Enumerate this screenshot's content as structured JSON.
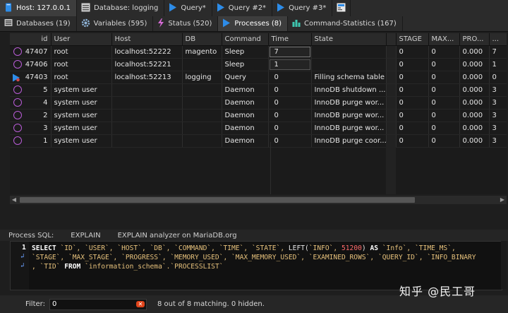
{
  "window_tabs": [
    {
      "label": "Host: 127.0.0.1",
      "icon": "host-icon",
      "active": true
    },
    {
      "label": "Database: logging",
      "icon": "database-icon",
      "active": false
    },
    {
      "label": "Query*",
      "icon": "query-play-icon",
      "active": false
    },
    {
      "label": "Query #2*",
      "icon": "query-play-icon",
      "active": false
    },
    {
      "label": "Query #3*",
      "icon": "query-play-icon",
      "active": false
    }
  ],
  "host_tabs": [
    {
      "label": "Databases (19)",
      "icon": "databases-icon",
      "active": false
    },
    {
      "label": "Variables (595)",
      "icon": "gear-icon",
      "active": false
    },
    {
      "label": "Status (520)",
      "icon": "status-icon",
      "active": false
    },
    {
      "label": "Processes (8)",
      "icon": "play-icon",
      "active": true
    },
    {
      "label": "Command-Statistics (167)",
      "icon": "bar-chart-icon",
      "active": false
    }
  ],
  "grid": {
    "columns": [
      "id",
      "User",
      "Host",
      "DB",
      "Command",
      "Time",
      "State",
      "",
      "STAGE",
      "MAX...",
      "PRO...",
      "..."
    ],
    "rows": [
      {
        "icon": "sleep",
        "id": "47407",
        "user": "root",
        "host": "localhost:52222",
        "db": "magento",
        "command": "Sleep",
        "time": "7",
        "state": "",
        "stage": "0",
        "max": "0",
        "pro": "0.000",
        "extra": "7"
      },
      {
        "icon": "sleep",
        "id": "47406",
        "user": "root",
        "host": "localhost:52221",
        "db": "",
        "command": "Sleep",
        "time": "1",
        "state": "",
        "stage": "0",
        "max": "0",
        "pro": "0.000",
        "extra": "1"
      },
      {
        "icon": "query",
        "id": "47403",
        "user": "root",
        "host": "localhost:52213",
        "db": "logging",
        "command": "Query",
        "time": "0",
        "state": "Filling schema table",
        "stage": "0",
        "max": "0",
        "pro": "0.000",
        "extra": "0"
      },
      {
        "icon": "sleep",
        "id": "5",
        "user": "system user",
        "host": "",
        "db": "",
        "command": "Daemon",
        "time": "0",
        "state": "InnoDB shutdown ...",
        "stage": "0",
        "max": "0",
        "pro": "0.000",
        "extra": "3"
      },
      {
        "icon": "sleep",
        "id": "4",
        "user": "system user",
        "host": "",
        "db": "",
        "command": "Daemon",
        "time": "0",
        "state": "InnoDB purge wor...",
        "stage": "0",
        "max": "0",
        "pro": "0.000",
        "extra": "3"
      },
      {
        "icon": "sleep",
        "id": "2",
        "user": "system user",
        "host": "",
        "db": "",
        "command": "Daemon",
        "time": "0",
        "state": "InnoDB purge wor...",
        "stage": "0",
        "max": "0",
        "pro": "0.000",
        "extra": "3"
      },
      {
        "icon": "sleep",
        "id": "3",
        "user": "system user",
        "host": "",
        "db": "",
        "command": "Daemon",
        "time": "0",
        "state": "InnoDB purge wor...",
        "stage": "0",
        "max": "0",
        "pro": "0.000",
        "extra": "3"
      },
      {
        "icon": "sleep",
        "id": "1",
        "user": "system user",
        "host": "",
        "db": "",
        "command": "Daemon",
        "time": "0",
        "state": "InnoDB purge coor...",
        "stage": "0",
        "max": "0",
        "pro": "0.000",
        "extra": "3"
      }
    ]
  },
  "sql_tabs": [
    "Process SQL:",
    "EXPLAIN",
    "EXPLAIN analyzer on MariaDB.org"
  ],
  "sql": {
    "line_number": "1",
    "line1": [
      {
        "t": "SELECT ",
        "c": "kw"
      },
      {
        "t": "`ID`, `USER`, `HOST`, `DB`, `COMMAND`, `TIME`, `STATE`, ",
        "c": "id"
      },
      {
        "t": "LEFT(",
        "c": "fn"
      },
      {
        "t": "`INFO`, ",
        "c": "id"
      },
      {
        "t": "51200",
        "c": "numlit"
      },
      {
        "t": ") ",
        "c": "fn"
      },
      {
        "t": "AS ",
        "c": "kw"
      },
      {
        "t": "`Info`, `TIME_MS`,",
        "c": "id"
      }
    ],
    "line2": [
      {
        "t": "`STAGE`, `MAX_STAGE`, `PROGRESS`, `MEMORY_USED`, `MAX_MEMORY_USED`, `EXAMINED_ROWS`, `QUERY_ID`, `INFO_BINARY",
        "c": "id"
      }
    ],
    "line3": [
      {
        "t": ", `TID` ",
        "c": "id"
      },
      {
        "t": "FROM ",
        "c": "kw"
      },
      {
        "t": "`information_schema`.`PROCESSLIST`",
        "c": "id"
      }
    ]
  },
  "filter": {
    "label": "Filter:",
    "value": "0",
    "match_text": "8 out of 8 matching. 0 hidden."
  },
  "watermark": "知乎 @民工哥",
  "colors": {
    "sleep_ring": "#b85cd6",
    "query_arrow": "#2d8ce8",
    "number_literal": "#ff6b6b",
    "identifier": "#e5c07b",
    "clear_button": "#e0441b"
  }
}
